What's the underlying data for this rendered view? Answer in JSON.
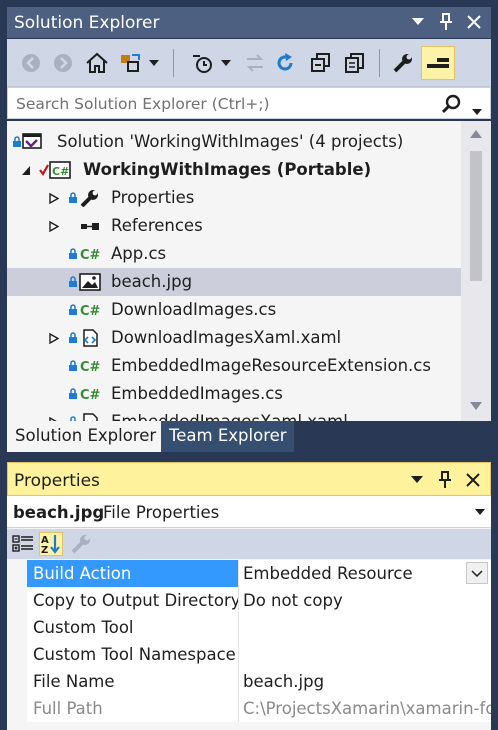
{
  "solution_explorer": {
    "title": "Solution Explorer",
    "search_placeholder": "Search Solution Explorer (Ctrl+;)",
    "tree": [
      {
        "label": "Solution 'WorkingWithImages' (4 projects)",
        "icon": "solution-icon"
      },
      {
        "label": "WorkingWithImages (Portable)",
        "icon": "csharp-project-icon",
        "bold": true,
        "expanded": true
      },
      {
        "label": "Properties",
        "icon": "wrench-icon"
      },
      {
        "label": "References",
        "icon": "references-icon"
      },
      {
        "label": "App.cs",
        "icon": "csharp-file-icon"
      },
      {
        "label": "beach.jpg",
        "icon": "image-file-icon",
        "selected": true
      },
      {
        "label": "DownloadImages.cs",
        "icon": "csharp-file-icon"
      },
      {
        "label": "DownloadImagesXaml.xaml",
        "icon": "xaml-file-icon"
      },
      {
        "label": "EmbeddedImageResourceExtension.cs",
        "icon": "csharp-file-icon"
      },
      {
        "label": "EmbeddedImages.cs",
        "icon": "csharp-file-icon"
      },
      {
        "label": "EmbeddedImagesXaml.xaml",
        "icon": "xaml-file-icon"
      }
    ],
    "tabs": [
      {
        "label": "Solution Explorer",
        "active": true
      },
      {
        "label": "Team Explorer",
        "active": false
      }
    ]
  },
  "properties": {
    "title": "Properties",
    "object_name": "beach.jpg",
    "object_type": "File Properties",
    "rows": [
      {
        "name": "Build Action",
        "value": "Embedded Resource",
        "selected": true,
        "dropdown": true
      },
      {
        "name": "Copy to Output Directory",
        "value": "Do not copy"
      },
      {
        "name": "Custom Tool",
        "value": ""
      },
      {
        "name": "Custom Tool Namespace",
        "value": ""
      },
      {
        "name": "File Name",
        "value": "beach.jpg"
      },
      {
        "name": "Full Path",
        "value": "C:\\ProjectsXamarin\\xamarin-for",
        "readonly": true
      }
    ]
  },
  "colors": {
    "title_bar": "#4d6082",
    "frame": "#293955",
    "toolbar": "#cfd6e5",
    "tree_bg": "#f5f5f5",
    "selection": "#cccedb",
    "active_title": "#fff29d",
    "property_selected": "#3399ff",
    "csharp_green": "#388a34",
    "lock_blue": "#1e7ad2",
    "checkmark_red": "#c5141d"
  }
}
